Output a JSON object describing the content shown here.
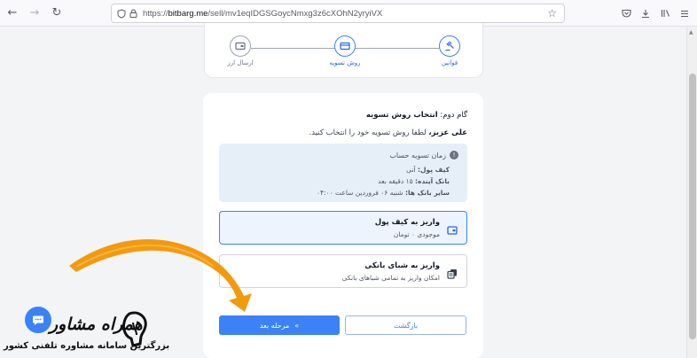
{
  "browser": {
    "url_prefix": "https://",
    "url_host": "bitbarg.me",
    "url_path": "/sell/mv1eqIDGSGoycNmxg3z6cXOhN2yryiVX"
  },
  "stepper": {
    "steps": [
      {
        "label": "قوانین",
        "state": "done"
      },
      {
        "label": "روش تسویه",
        "state": "current"
      },
      {
        "label": "ارسال ارز",
        "state": "pending"
      }
    ]
  },
  "page": {
    "step_prefix": "گام دوم:",
    "step_title": "انتخاب روش تسویه",
    "greeting_name": "علی عزیز،",
    "greeting_text": "لطفا روش تسویه خود را انتخاب کنید.",
    "info": {
      "heading": "زمان تسویه حساب",
      "wallet_label": "کیف پول:",
      "wallet_value": "آنی",
      "bank_label": "بانک آینده:",
      "bank_value": "۱۵ دقیقه بعد",
      "others_label": "سایر بانک ها:",
      "others_value": "شنبه ۰۶ فروردین ساعت ۰۴:۰۰"
    },
    "options": [
      {
        "title": "واریز به کیف پول",
        "subtitle": "موجودی ۰ تومان",
        "selected": true,
        "icon": "wallet-icon"
      },
      {
        "title": "واریز به شبای بانکی",
        "subtitle": "امکان واریز به تمامی شباهای بانکی",
        "selected": false,
        "icon": "copy-icon"
      }
    ],
    "next_label": "مرحله بعد",
    "back_label": "بازگشت"
  },
  "watermark": {
    "brand": "همراه مشاور",
    "tagline": "بزرگترین سامانه مشاوره تلفنی کشور"
  },
  "colors": {
    "accent": "#3b82f6",
    "info_bg": "#e6eef8",
    "arrow": "#f29a0f"
  }
}
